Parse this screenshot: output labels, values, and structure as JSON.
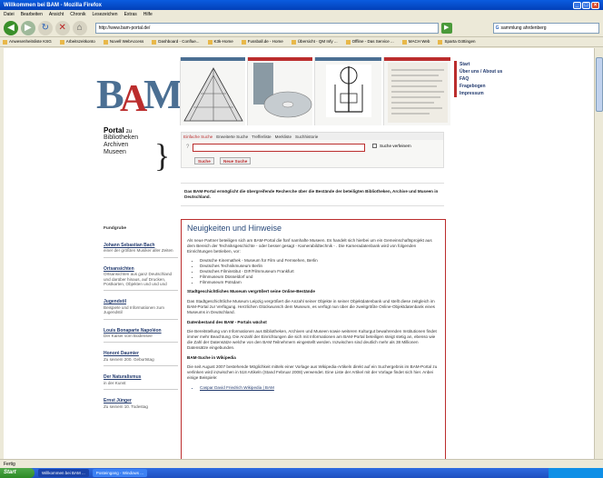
{
  "window": {
    "title": "Willkommen bei BAM - Mozilla Firefox",
    "controls": [
      "_",
      "□",
      "×"
    ]
  },
  "menu": [
    "Datei",
    "Bearbeiten",
    "Ansicht",
    "Chronik",
    "Lesezeichen",
    "Extras",
    "Hilfe"
  ],
  "nav": {
    "url": "http://www.bam-portal.de/",
    "search_value": "sammlung ahrdenberg"
  },
  "bookmarks": [
    "Anwesenheitsliste KSG",
    "Arbeitszeitkonto",
    "Novell WebAccess",
    "Dashboard - Conflue...",
    "K3k-Home",
    "Fussball.de - Home",
    "Übersicht - QM Infy ...",
    "Offline - Das Service ...",
    "MACH Web",
    "Sparta Göttingen"
  ],
  "page": {
    "top_links": [
      "Start",
      "Über uns / About us",
      "FAQ",
      "Fragebogen",
      "Impressum"
    ],
    "portal": {
      "word": "Portal",
      "zu": "zu",
      "lines": [
        "Bibliotheken",
        "Archiven",
        "Museen"
      ]
    },
    "search": {
      "tabs": [
        "Einfache Suche",
        "Erweiterte Suche",
        "Trefferliste",
        "Merkliste",
        "Suchhistorie"
      ],
      "relax_label": "Suche verfeinern",
      "buttons": [
        "Suche",
        "Neue Suche"
      ]
    },
    "intro": "Das BAM-Portal ermöglicht die übergreifende Recherche über die Bestände der beteiligten Bibliotheken, Archive und Museen in Deutschland.",
    "sidebar": {
      "heading": "Fundgrube",
      "items": [
        {
          "title": "Johann Sebastian Bach",
          "text": "einer der größten Musiker aller Zeiten"
        },
        {
          "title": "Ortsansichten",
          "text": "Ortsansichten aus ganz Deutschland und darüber hinaus, auf Drucken, Postkarten, Objekten und und und"
        },
        {
          "title": "Jugendstil",
          "text": "Beispiele und Informationen zum Jugendstil"
        },
        {
          "title": "Louis Bonaparte Napoléon",
          "text": "Der Kaiser vom Bodensee"
        },
        {
          "title": "Honoré Daumier",
          "text": "Zu seinem 200. Geburtstag"
        },
        {
          "title": "Der Naturalismus",
          "text": "in der Kunst"
        },
        {
          "title": "Ernst Jünger",
          "text": "Zu seinem 10. Todestag"
        }
      ]
    },
    "news": {
      "heading": "Neuigkeiten und Hinweise",
      "p1": "Als neue Partner beteiligen sich am BAM-Portal die fünf namhafte Museen. Es handelt sich hierbei um ein Gemeinschaftsprojekt aus dem Bereich der Techniksgeschichte - oder besser gesagt - Kamerabildtechnik - . Die Kameradatenbank wird von folgenden Einrichtungen betrieben, vor:",
      "list": [
        "Deutsche Kinemathek - Museum für Film und Fernsehen, Berlin",
        "Deutsches Technikmuseum Berlin",
        "Deutsches Filminstitut - DIF/Filmmuseum Frankfurt",
        "Filmmuseum Düsseldorf und",
        "Filmmuseum Potsdam"
      ],
      "h2": "Stadtgeschichtliches Museum vergrößert seine Online-Bestände",
      "p2": "Das Stadtgeschichtliche Museum Leipzig vergrößert die Anzahl seiner Objekte in seiner Objektdatenbank und stellt diese zeitgleich im BAM-Portal zur Verfügung. Herzlichen Glückwunsch dem Museum, es verfügt nun über die zweitgrößte Online-Objektdatenbank eines Museums in Deutschland.",
      "h3": "Datenbestand des BAM - Portals wächst",
      "p3": "Die Bereitstellung von Informationen aus Bibliotheken, Archiven und Museen sowie weiteren Kulturgut bewahrenden Institutionen findet immer mehr Beachtung. Die Anzahl der Einrichtungen die sich mit Informationen am BAM-Portal beteiligen steigt stetig an, ebenso wie die Zahl der Datensätze welche von den BAM Teilnehmern eingestellt werden. Inzwischen sind deutlich mehr als 38 Millionen Datensätze eingebunden.",
      "h4": "BAM-Suche in Wikipedia",
      "p4": "Die seit August 2007 bestehende Möglichkeit mittels einer Vorlage aus Wikipedia-Artikeln direkt auf ein Suchergebnis im BAM-Portal zu verlinken wird inzwischen in 518 Artikeln (Stand Februar 2008) verwendet. Eine Liste der Artikel mit der Vorlage findet sich hier. Anbei einige Beispiele:",
      "list2": [
        "Caspar David Friedrich Wikipedia | BAM"
      ]
    }
  },
  "status": "Fertig",
  "taskbar": {
    "start": "Start",
    "tasks": [
      "Willkommen bei BAM ...",
      "Posteingang - Windows ..."
    ]
  }
}
